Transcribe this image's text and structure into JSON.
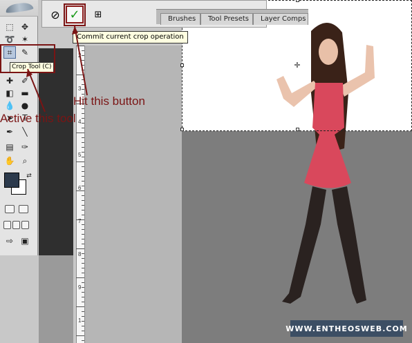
{
  "tooltips": {
    "commit": "Commit current crop operation",
    "crop_tool": "Crop Tool (C)"
  },
  "options_bar": {
    "cancel_icon": "cancel-icon",
    "commit_icon": "checkmark-icon",
    "palette_tabs": [
      "Brushes",
      "Tool Presets",
      "Layer Comps"
    ]
  },
  "annotations": {
    "hit_button": "Hit this button",
    "active_tool": "Active this tool"
  },
  "ruler": {
    "numbers": [
      "2",
      "3",
      "4",
      "5",
      "6",
      "7",
      "8",
      "9",
      "1"
    ]
  },
  "watermark": "WWW.ENTHEOSWEB.COM",
  "colors": {
    "annotation": "#7a1414",
    "foreground_swatch": "#2c3a4c",
    "background_swatch": "#ffffff",
    "commit_check": "#1a9a1a",
    "dress": "#d9485c"
  }
}
